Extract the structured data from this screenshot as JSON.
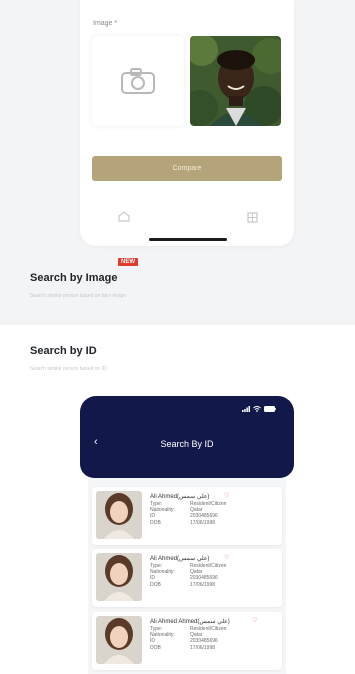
{
  "top_phone": {
    "image_label": "Image *",
    "compare_label": "Compare",
    "icons": {
      "camera": "camera-icon",
      "nav_left": "home-icon",
      "nav_right": "grid-icon"
    }
  },
  "search_by_image": {
    "title": "Search by Image",
    "badge": "NEW",
    "subtitle": "Search similar person based on face image"
  },
  "search_by_id": {
    "title": "Search by ID",
    "subtitle": "Search similar person based on ID"
  },
  "app": {
    "header_title": "Search By ID",
    "back_icon": "chevron-left-icon",
    "status_icons": [
      "signal-icon",
      "wifi-icon",
      "battery-icon"
    ]
  },
  "results": [
    {
      "name": "Ali Ahmed",
      "name_ar": "(علي سمس)",
      "type_label": "Type:",
      "type": "Resident/Citizen",
      "nationality_label": "Nationality:",
      "nationality": "Qatar",
      "id_label": "ID",
      "id": "2030485696",
      "dob_label": "DOB",
      "dob": "17/06/1998"
    },
    {
      "name": "Ali Ahmed",
      "name_ar": "(علي سمس)",
      "type_label": "Type:",
      "type": "Resident/Citizen",
      "nationality_label": "Nationality:",
      "nationality": "Qatar",
      "id_label": "ID",
      "id": "2030485696",
      "dob_label": "DOB",
      "dob": "17/06/1998"
    },
    {
      "name": "Ali Ahmed Ahmed",
      "name_ar": "(علي سمس)",
      "type_label": "Type:",
      "type": "Resident/Citizen",
      "nationality_label": "Nationality:",
      "nationality": "Qatar",
      "id_label": "ID",
      "id": "2030485696",
      "dob_label": "DOB",
      "dob": "17/06/1998"
    }
  ],
  "colors": {
    "accent_gold": "#b5a47a",
    "header_navy": "#12194a",
    "badge_red": "#e23a2e"
  }
}
